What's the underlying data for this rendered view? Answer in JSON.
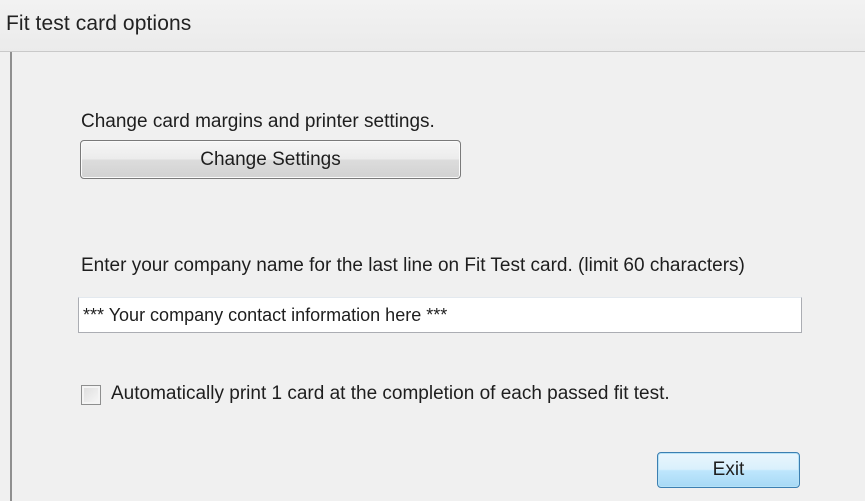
{
  "window": {
    "title": "Fit test card options"
  },
  "settings_section": {
    "label": "Change card margins and printer settings.",
    "button_label": "Change Settings"
  },
  "company_section": {
    "label": "Enter your company name for the last line on Fit Test card. (limit 60 characters)",
    "input_value": "*** Your company contact information here ***"
  },
  "auto_print": {
    "label": "Automatically print 1 card at the completion of each passed fit test.",
    "checked": false
  },
  "footer": {
    "exit_label": "Exit"
  }
}
